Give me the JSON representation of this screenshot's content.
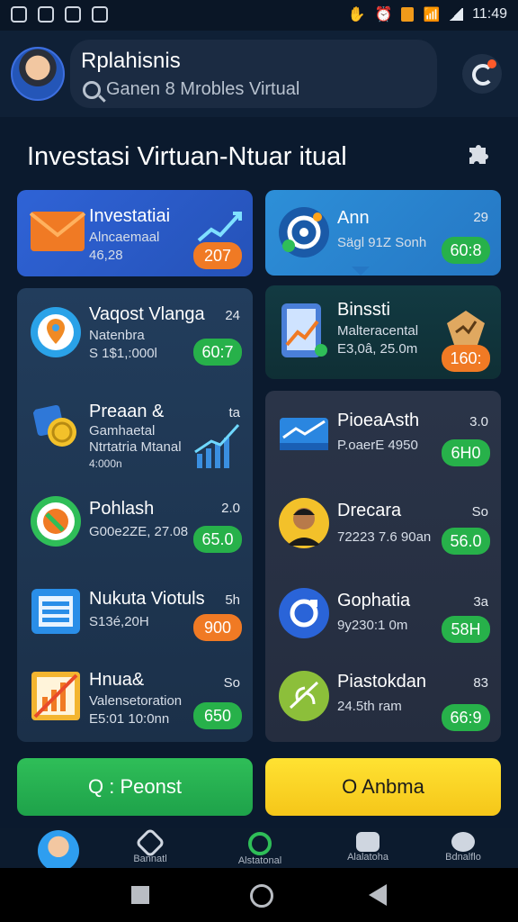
{
  "status_bar": {
    "time": "11:49"
  },
  "header": {
    "title": "Rplahisnis",
    "search_text": "Ganen 8 Mrobles Virtual",
    "avatar_icon": "avatar-user",
    "notification_icon": "bell-icon",
    "notification_dot_color": "#ff5a2a"
  },
  "page": {
    "title": "Investasi Virtuan-Ntuar itual",
    "settings_icon": "puzzle-icon"
  },
  "cards": {
    "top_left": {
      "title": "Investatiai",
      "subtitle": "Alncaemaal",
      "value": "46,28",
      "pill": "207",
      "icon": "envelope-icon",
      "chart_icon": "trend-chart-icon"
    },
    "top_right": {
      "title": "Ann",
      "number": "29",
      "subtitle": "Sägl 91Z Sonh",
      "pill": "60:8",
      "icon": "target-icon"
    },
    "left_list": [
      {
        "title": "Vaqost Vlanga",
        "number": "24",
        "line2": "Natenbra",
        "line3": "S 1$1,:000l",
        "pill": "60:7",
        "pill_color": "green",
        "icon": "map-pin-icon"
      },
      {
        "title": "Preaan &",
        "number": "ta",
        "line2": "Gamhaetal",
        "line3": "Ntrtatria Mtanal",
        "line4": "4:000n",
        "pill": "",
        "pill_color": "",
        "icon": "coins-icon"
      },
      {
        "title": "Pohlash",
        "number": "2.0",
        "line2": "G00e2ZE, 27.08",
        "line3": "",
        "pill": "65.0",
        "pill_color": "green",
        "icon": "leaf-icon"
      },
      {
        "title": "Nukuta Viotuls",
        "number": "5h",
        "line2": "S13é,20H",
        "line3": "",
        "pill": "900",
        "pill_color": "orange",
        "icon": "spreadsheet-icon"
      },
      {
        "title": "Hnua&",
        "number": "So",
        "line2": "Valensetoration",
        "line3": "E5:01 10:0nn",
        "pill": "650",
        "pill_color": "green",
        "icon": "chart-frame-icon"
      }
    ],
    "right_single": {
      "title": "Binssti",
      "line2": "Malteracental",
      "line3": "E3,0â, 25.0m",
      "pill": "160:",
      "pill_color": "orange",
      "icon": "phone-chart-icon"
    },
    "right_list": [
      {
        "title": "PioeaAsth",
        "number": "3.0",
        "line2": "P.oaerE 4950",
        "pill": "6H0",
        "pill_color": "green",
        "icon": "card-icon"
      },
      {
        "title": "Drecara",
        "number": "So",
        "line2": "72223 7.6 90an",
        "pill": "56.0",
        "pill_color": "green",
        "icon": "person-icon"
      },
      {
        "title": "Gophatia",
        "number": "3a",
        "line2": "9y230:1 0m",
        "pill": "58H",
        "pill_color": "green",
        "icon": "refresh-icon"
      },
      {
        "title": "Piastokdan",
        "number": "83",
        "line2": "24.5th ram",
        "pill": "66:9",
        "pill_color": "green",
        "icon": "plant-icon"
      }
    ]
  },
  "actions": {
    "primary": "Q : Peonst",
    "secondary": "O Anbma"
  },
  "bottom_nav": {
    "items": [
      {
        "label": "",
        "icon": "avatar-icon"
      },
      {
        "label": "Bannatl",
        "icon": "tag-icon"
      },
      {
        "label": "Alstatonal",
        "icon": "refresh-icon"
      },
      {
        "label": "Alalatoha",
        "icon": "wallet-icon"
      },
      {
        "label": "Bdnalflo",
        "icon": "mail-icon"
      }
    ]
  }
}
